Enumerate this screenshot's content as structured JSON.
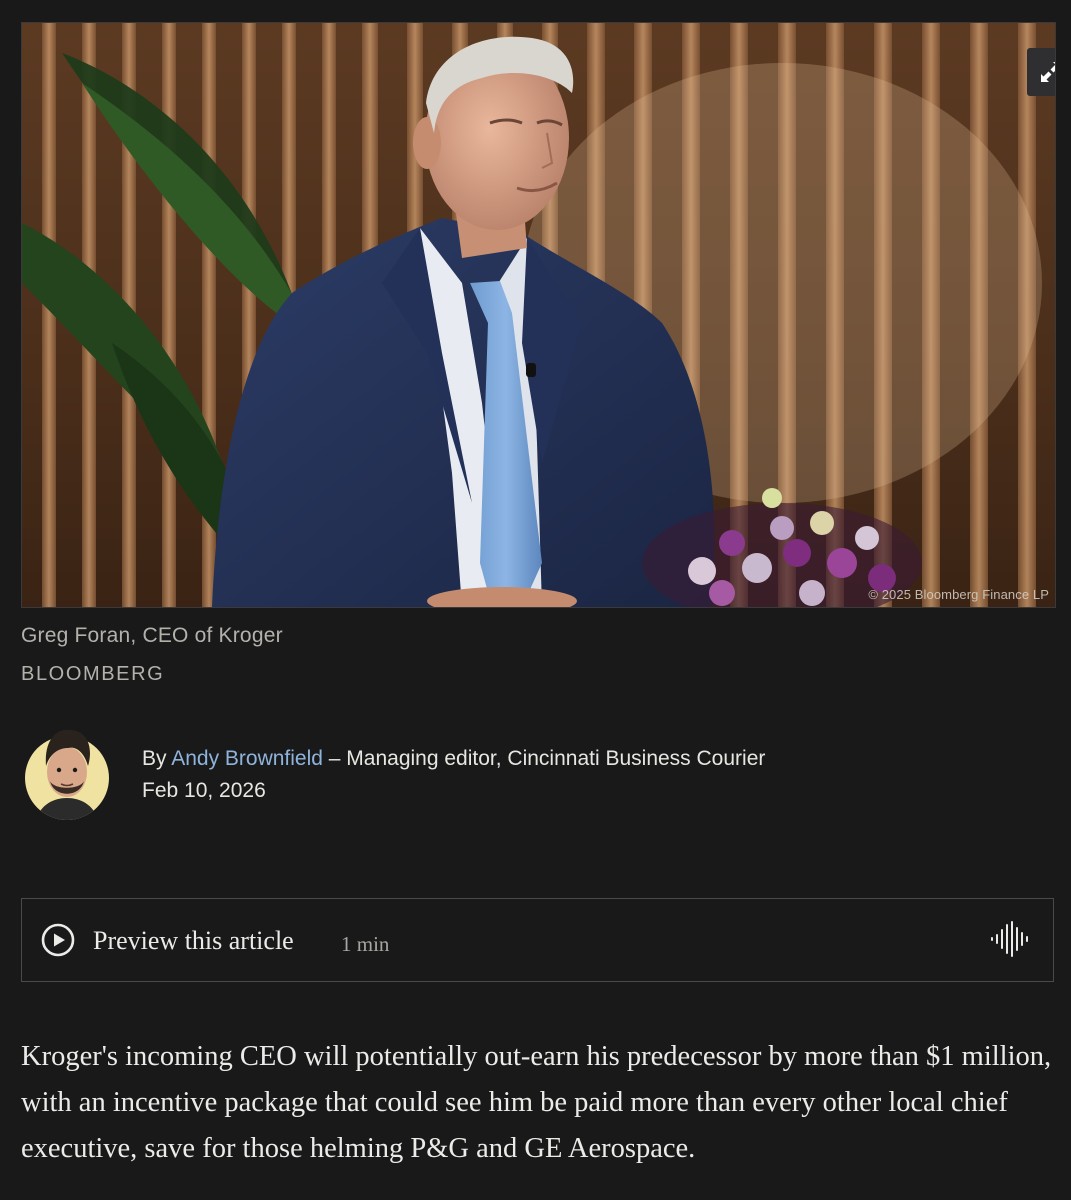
{
  "photo": {
    "credit": "© 2025 Bloomberg Finance LP",
    "expand_icon": "expand-arrows-icon"
  },
  "caption": {
    "text": "Greg Foran, CEO of Kroger",
    "source": "BLOOMBERG"
  },
  "byline": {
    "prefix": "By",
    "author": "Andy Brownfield",
    "role": "– Managing editor, Cincinnati Business Courier",
    "date": "Feb 10, 2026"
  },
  "preview": {
    "label": "Preview this article",
    "duration": "1 min",
    "play_icon": "play-icon",
    "audio_icon": "waveform-icon"
  },
  "article": {
    "lead": "Kroger's incoming CEO will potentially out-earn his predecessor by more than $1 million, with an incentive package that could see him be paid more than every other local chief executive, save for those helming P&G and GE Aerospace."
  },
  "colors": {
    "background": "#19191a",
    "link": "#8fb4dc",
    "muted_text": "#b4b1ab"
  }
}
